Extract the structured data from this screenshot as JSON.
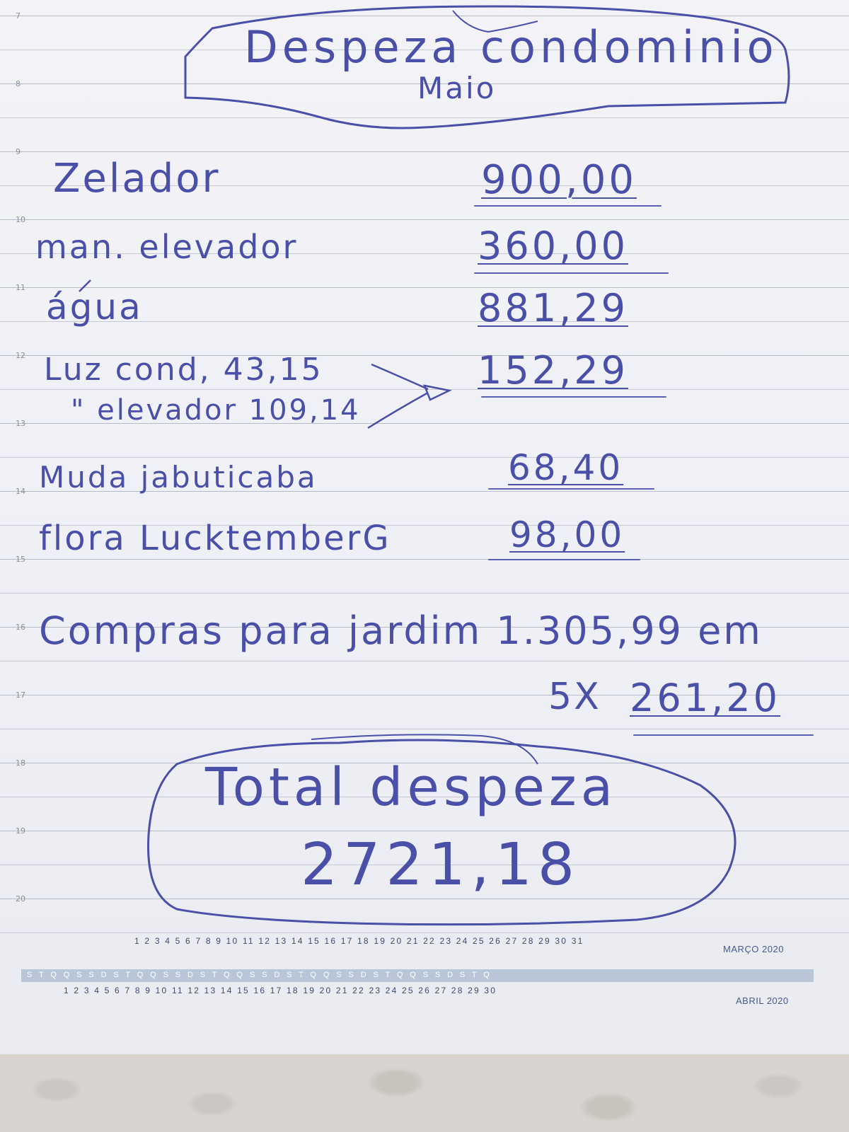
{
  "title": {
    "line1": "Despeza condominio",
    "line2": "Maio"
  },
  "hours": [
    "7",
    "8",
    "9",
    "10",
    "11",
    "12",
    "13",
    "14",
    "15",
    "16",
    "17",
    "18",
    "19",
    "20"
  ],
  "items": [
    {
      "label": "Zelador",
      "amount": "900,00"
    },
    {
      "label": "man. elevador",
      "amount": "360,00"
    },
    {
      "label": "água",
      "amount": "881,29"
    },
    {
      "label": "Luz cond, 43,15",
      "amount": "152,29"
    },
    {
      "label": "\" elevador 109,14",
      "amount": ""
    },
    {
      "label": "Muda jabuticaba",
      "amount": "68,40"
    },
    {
      "label": "flora LucktemberG",
      "amount": "98,00"
    }
  ],
  "garden": {
    "line": "Compras para jardim 1.305,99 em",
    "installments": "5X",
    "installment_value": "261,20"
  },
  "total": {
    "label": "Total despeza",
    "value": "2721,18"
  },
  "calendar": {
    "march_label": "MARÇO 2020",
    "april_label": "ABRIL 2020",
    "march_days": "1 2 3 4 5 6 7 8 9 10 11 12 13 14 15 16 17 18 19 20 21 22 23 24 25 26 27 28 29 30 31",
    "weekdays": "S T Q Q S S D S T Q Q S S D S T Q Q S S D S T Q Q S S D S T Q Q S S D S T Q",
    "april_days": "1 2 3 4 5 6 7 8 9 10 11 12 13 14 15 16 17 18 19 20 21 22 23 24 25 26 27 28 29 30"
  },
  "colors": {
    "ink": "#4a4fa8",
    "rule": "#c5c9d6",
    "calendar_band": "#b8c6d8"
  }
}
